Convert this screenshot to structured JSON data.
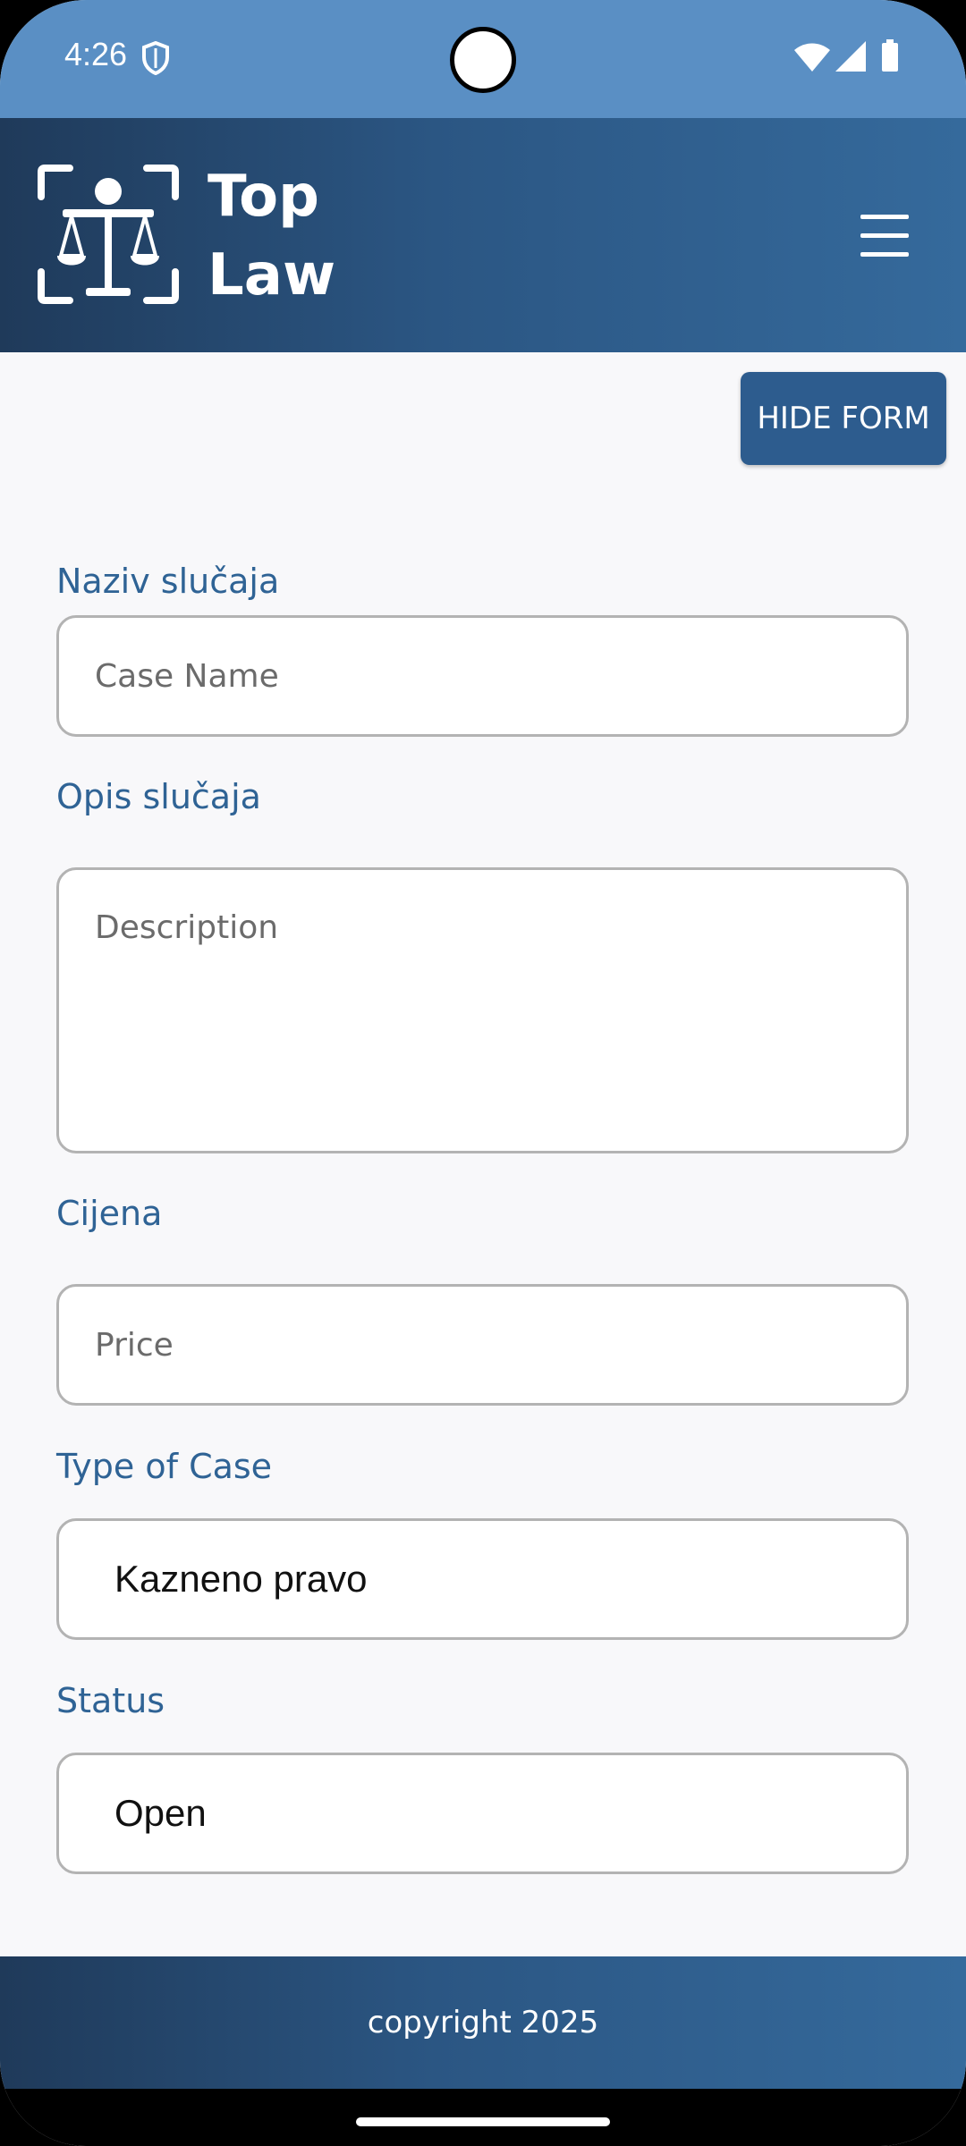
{
  "status_bar": {
    "time": "4:26",
    "icons": [
      "shield-icon",
      "wifi-icon",
      "cell-signal-icon",
      "battery-icon"
    ]
  },
  "header": {
    "brand_line1": "Top",
    "brand_line2": "Law",
    "logo": "scales-of-justice-icon",
    "menu_icon": "hamburger-menu-icon"
  },
  "actions": {
    "hide_form_label": "HIDE FORM"
  },
  "form": {
    "case_name_label": "Naziv slučaja",
    "case_name_placeholder": "Case Name",
    "description_label": "Opis slučaja",
    "description_placeholder": "Description",
    "price_label": "Cijena",
    "price_placeholder": "Price",
    "type_label": "Type of Case",
    "type_value": "Kazneno pravo",
    "status_label": "Status",
    "status_value": "Open"
  },
  "footer": {
    "copyright": "copyright 2025"
  },
  "colors": {
    "primary": "#2d5c8e",
    "header_dark": "#1f3a5a",
    "status_bar": "#5a8fc4",
    "label": "#2f6395",
    "background": "#f8f8fa"
  }
}
